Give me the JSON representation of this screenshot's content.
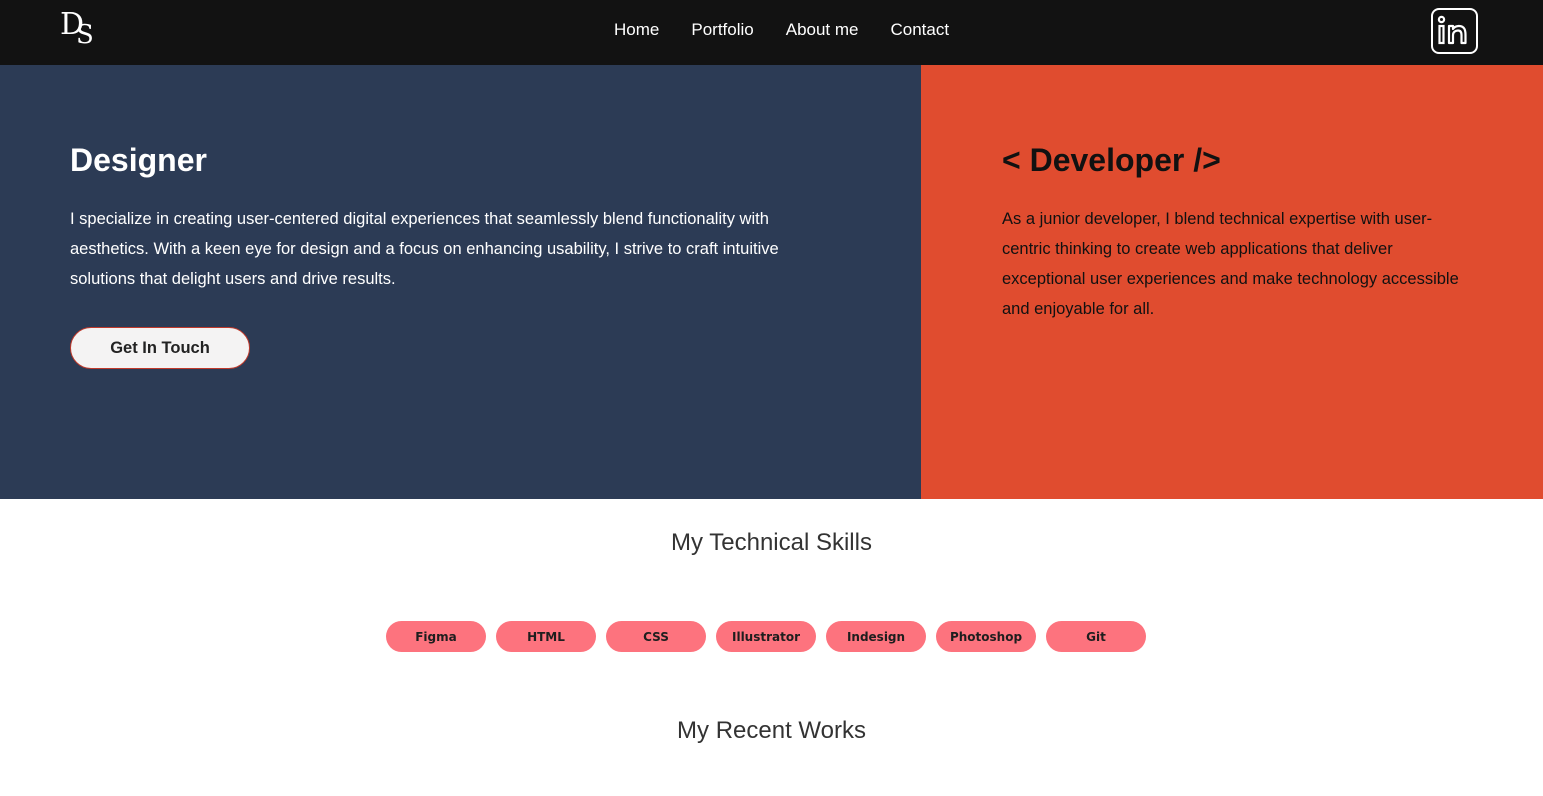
{
  "header": {
    "logo_text": "DS",
    "nav": [
      {
        "label": "Home"
      },
      {
        "label": "Portfolio"
      },
      {
        "label": "About me"
      },
      {
        "label": "Contact"
      }
    ],
    "social_icon": "linkedin-icon"
  },
  "hero": {
    "designer": {
      "title": "Designer",
      "text": "I specialize in creating user-centered digital experiences that seamlessly blend functionality with aesthetics. With a keen eye for design and a focus on enhancing usability, I strive to craft intuitive solutions that delight users and drive results.",
      "button_label": "Get In Touch"
    },
    "developer": {
      "title": "< Developer />",
      "text": "As a junior developer, I blend technical expertise with user-centric thinking to create web applications that deliver exceptional user experiences and make technology accessible and enjoyable for all."
    }
  },
  "skills": {
    "title": "My Technical Skills",
    "items": [
      "Figma",
      "HTML",
      "CSS",
      "Illustrator",
      "Indesign",
      "Photoshop",
      "Git"
    ]
  },
  "works": {
    "title": "My Recent Works"
  },
  "colors": {
    "header_bg": "#121212",
    "designer_bg": "#2c3b55",
    "developer_bg": "#e04c2f",
    "skill_pill": "#fd737e"
  }
}
